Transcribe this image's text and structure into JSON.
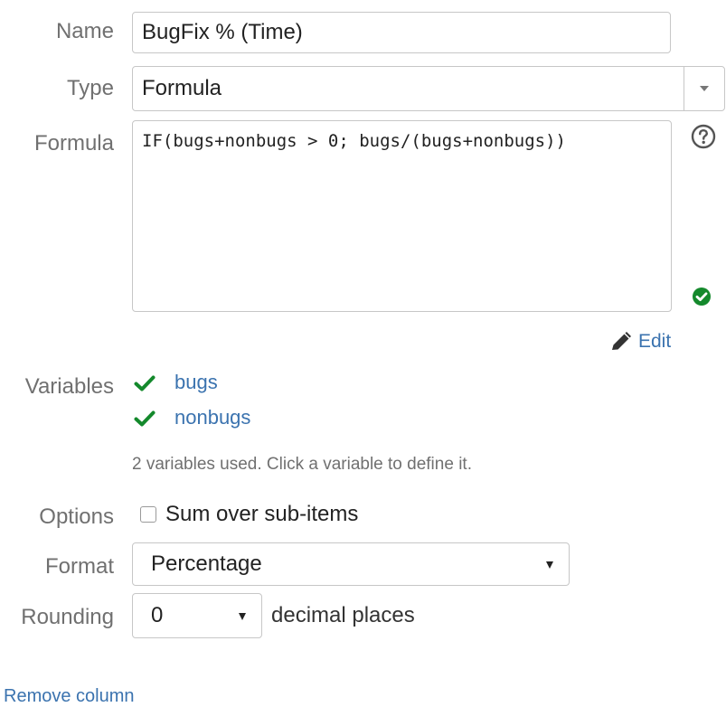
{
  "form": {
    "name": {
      "label": "Name",
      "value": "BugFix % (Time)"
    },
    "type": {
      "label": "Type",
      "value": "Formula"
    },
    "formula": {
      "label": "Formula",
      "value": "IF(bugs+nonbugs > 0; bugs/(bugs+nonbugs))",
      "help_icon": "question-circle-icon",
      "status_icon": "check-circle-icon",
      "status_color": "#14892c",
      "edit_label": "Edit",
      "edit_icon": "pencil-icon"
    },
    "variables": {
      "label": "Variables",
      "items": [
        {
          "name": "bugs",
          "status_icon": "check-icon"
        },
        {
          "name": "nonbugs",
          "status_icon": "check-icon"
        }
      ],
      "hint": "2 variables used. Click a variable to define it."
    },
    "options": {
      "label": "Options",
      "checkbox_label": "Sum over sub-items",
      "checked": false
    },
    "format": {
      "label": "Format",
      "value": "Percentage"
    },
    "rounding": {
      "label": "Rounding",
      "value": "0",
      "suffix": "decimal places"
    },
    "remove_link": "Remove column"
  },
  "colors": {
    "link": "#3b73af",
    "success": "#14892c",
    "label": "#707070"
  }
}
